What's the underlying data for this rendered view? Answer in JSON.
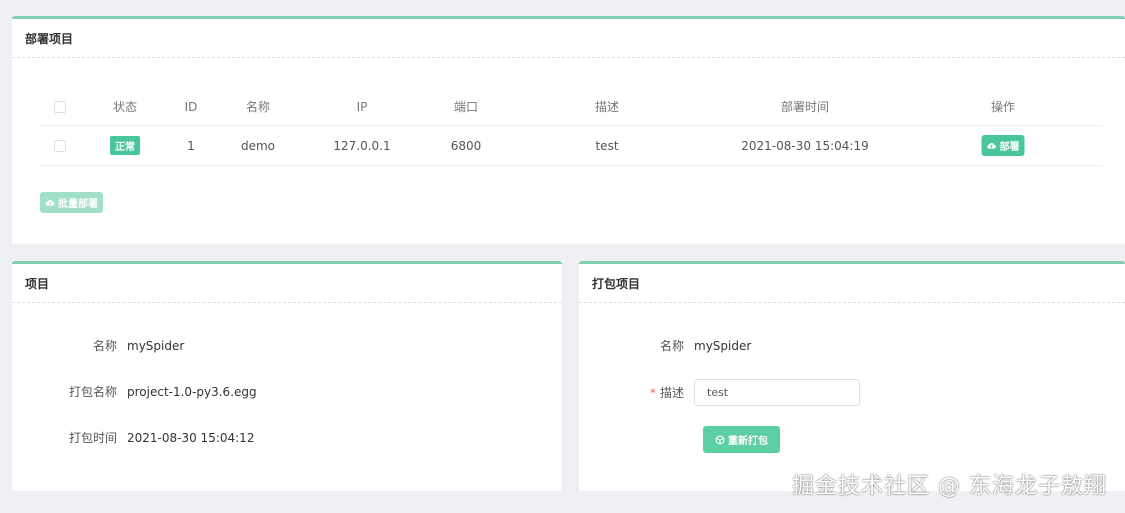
{
  "deploy_panel": {
    "title": "部署项目",
    "columns": [
      "状态",
      "ID",
      "名称",
      "IP",
      "端口",
      "描述",
      "部署时间",
      "操作"
    ],
    "rows": [
      {
        "status": "正常",
        "id": "1",
        "name": "demo",
        "ip": "127.0.0.1",
        "port": "6800",
        "description": "test",
        "deploy_time": "2021-08-30 15:04:19",
        "action_label": "部署"
      }
    ],
    "batch_deploy_label": "批量部署"
  },
  "project_panel": {
    "title": "项目",
    "fields": [
      {
        "label": "名称",
        "value": "mySpider"
      },
      {
        "label": "打包名称",
        "value": "project-1.0-py3.6.egg"
      },
      {
        "label": "打包时间",
        "value": "2021-08-30 15:04:12"
      }
    ]
  },
  "package_panel": {
    "title": "打包项目",
    "name_label": "名称",
    "name_value": "mySpider",
    "required_mark": "*",
    "desc_label": "描述",
    "desc_value": "test",
    "repack_label": "重新打包"
  },
  "watermark": "掘金技术社区 @ 东海龙子敖翔",
  "colors": {
    "accent": "#48c79a",
    "panel_top_border": "#7fcfb0",
    "background": "#eef0f3"
  },
  "icons": [
    "cloud-upload-icon",
    "package-icon"
  ]
}
